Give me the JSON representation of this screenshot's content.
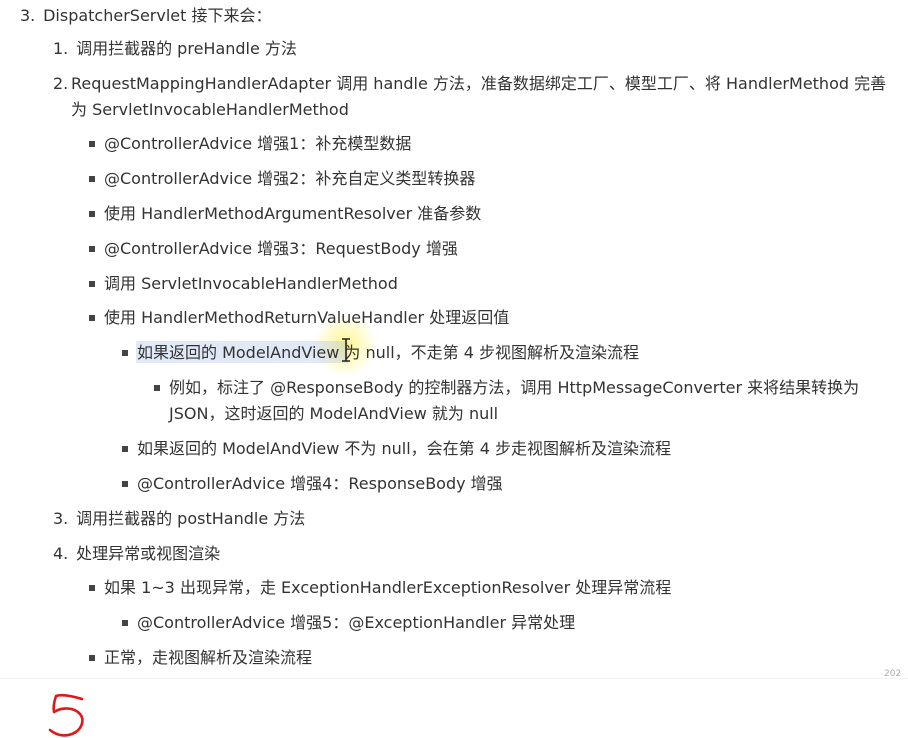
{
  "items": {
    "i3": {
      "num": "3.",
      "text": "DispatcherServlet 接下来会："
    },
    "i3_1": {
      "num": "1.",
      "text": "调用拦截器的 preHandle 方法"
    },
    "i3_2": {
      "num": "2.",
      "line1": "RequestMappingHandlerAdapter 调用 handle 方法，准备数据绑定工厂、模型工厂、将 HandlerMethod 完善",
      "line2": "为 ServletInvocableHandlerMethod"
    },
    "b1": "@ControllerAdvice 增强1：补充模型数据",
    "b2": "@ControllerAdvice 增强2：补充自定义类型转换器",
    "b3": "使用 HandlerMethodArgumentResolver 准备参数",
    "b4": "@ControllerAdvice 增强3：RequestBody 增强",
    "b5": "调用 ServletInvocableHandlerMethod",
    "b6": "使用 HandlerMethodReturnValueHandler 处理返回值",
    "s1": "如果返回的 ModelAndView 为 null，不走第 4 步视图解析及渲染流程",
    "t1": {
      "line1": "例如，标注了 @ResponseBody 的控制器方法，调用 HttpMessageConverter 来将结果转换为",
      "line2": "JSON，这时返回的 ModelAndView 就为 null"
    },
    "s2": "如果返回的 ModelAndView 不为 null，会在第 4 步走视图解析及渲染流程",
    "s3": "@ControllerAdvice 增强4：ResponseBody 增强",
    "i3_3": {
      "num": "3.",
      "text": "调用拦截器的 postHandle 方法"
    },
    "i3_4": {
      "num": "4.",
      "text": "处理异常或视图渲染"
    },
    "c1": "如果 1~3 出现异常，走 ExceptionHandlerExceptionResolver 处理异常流程",
    "c1a": "@ControllerAdvice 增强5：@ExceptionHandler 异常处理",
    "c2": "正常，走视图解析及渲染流程"
  },
  "corner_mark": "202",
  "colors": {
    "text": "#333333",
    "highlight": "#aabee6",
    "cursor_glow": "#fff050",
    "handwriting": "#e01818"
  }
}
